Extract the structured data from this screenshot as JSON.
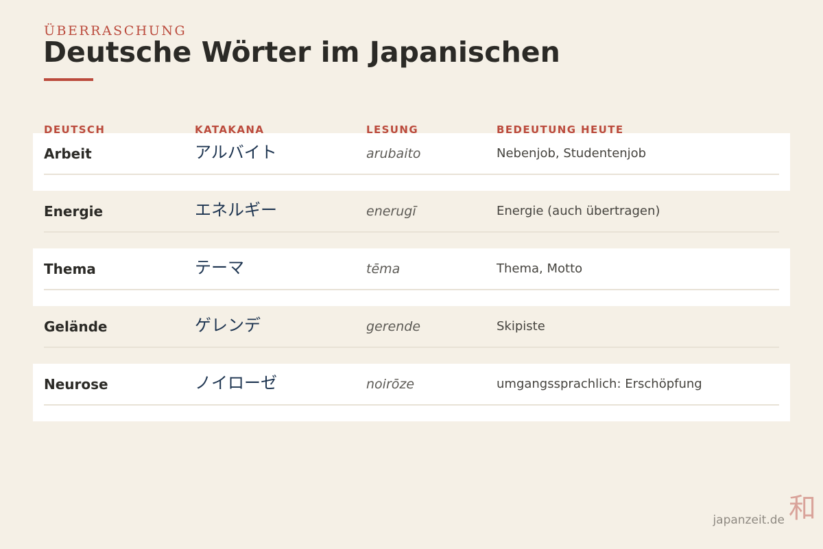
{
  "header": {
    "kicker": "ÜBERRASCHUNG",
    "title": "Deutsche Wörter im Japanischen"
  },
  "columns": {
    "deutsch": "DEUTSCH",
    "katakana": "KATAKANA",
    "lesung": "LESUNG",
    "bedeutung": "BEDEUTUNG HEUTE"
  },
  "rows": [
    {
      "deutsch": "Arbeit",
      "katakana": "アルバイト",
      "lesung": "arubaito",
      "bedeutung": "Nebenjob, Studentenjob"
    },
    {
      "deutsch": "Energie",
      "katakana": "エネルギー",
      "lesung": "enerugī",
      "bedeutung": "Energie (auch übertragen)"
    },
    {
      "deutsch": "Thema",
      "katakana": "テーマ",
      "lesung": "tēma",
      "bedeutung": "Thema, Motto"
    },
    {
      "deutsch": "Gelände",
      "katakana": "ゲレンデ",
      "lesung": "gerende",
      "bedeutung": "Skipiste"
    },
    {
      "deutsch": "Neurose",
      "katakana": "ノイローゼ",
      "lesung": "noirōze",
      "bedeutung": "umgangssprachlich: Erschöpfung"
    }
  ],
  "footer": {
    "site": "japanzeit.de",
    "mark": "和"
  },
  "colors": {
    "background": "#f5f0e6",
    "accent": "#bb4a3c",
    "katakana": "#1d3450",
    "row_alt": "#ffffff"
  }
}
